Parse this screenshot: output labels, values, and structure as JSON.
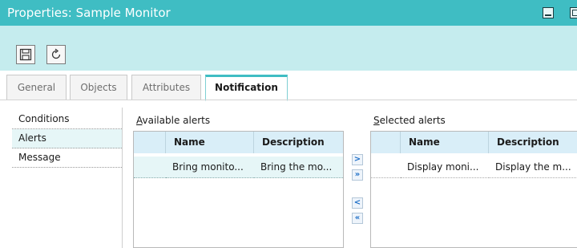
{
  "window": {
    "title": "Properties: Sample Monitor"
  },
  "toolbar": {
    "save_icon": "save-icon",
    "refresh_icon": "refresh-icon"
  },
  "tabs": [
    {
      "label": "General",
      "active": false
    },
    {
      "label": "Objects",
      "active": false
    },
    {
      "label": "Attributes",
      "active": false
    },
    {
      "label": "Notification",
      "active": true
    }
  ],
  "sidebar": {
    "items": [
      {
        "label": "Conditions",
        "selected": false
      },
      {
        "label": "Alerts",
        "selected": true
      },
      {
        "label": "Message",
        "selected": false
      }
    ]
  },
  "available_alerts": {
    "label_accel": "A",
    "label_rest": "vailable alerts",
    "columns": [
      "Name",
      "Description"
    ],
    "rows": [
      {
        "name": "Bring monito...",
        "description": "Bring the mo..."
      }
    ]
  },
  "selected_alerts": {
    "label_accel": "S",
    "label_rest": "elected alerts",
    "columns": [
      "Name",
      "Description"
    ],
    "rows": [
      {
        "name": "Display moni...",
        "description": "Display the m..."
      }
    ]
  },
  "move_buttons": {
    "add": ">",
    "add_all": "»",
    "remove": "<",
    "remove_all": "«"
  },
  "colors": {
    "titlebar": "#3fbdc3",
    "toolbar": "#c5ecee",
    "grid_header": "#d9eef8",
    "selection": "#e6f6f7"
  }
}
